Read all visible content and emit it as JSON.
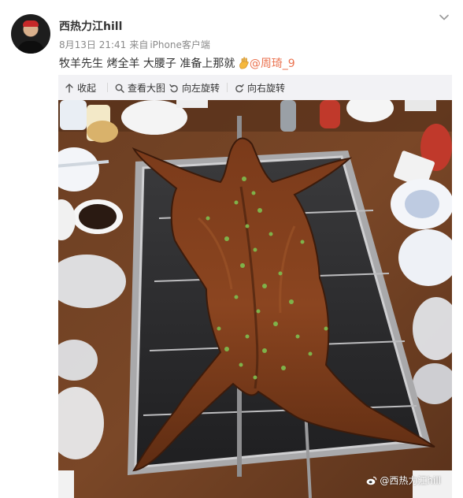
{
  "post": {
    "username": "西热力江hill",
    "date": "8月13日 21:41",
    "source_prefix": "来自",
    "source": "iPhone客户端",
    "text": "牧羊先生 烤全羊 大腰子 准备上那就 ",
    "mention": "@周琦_9"
  },
  "toolbar": {
    "collapse_label": "收起",
    "view_large_label": "查看大图",
    "rotate_left_label": "向左旋转",
    "rotate_right_label": "向右旋转"
  },
  "image": {
    "watermark": "@西热力江hill"
  },
  "colors": {
    "accent": "#eb7350",
    "meta_text": "#8a8a8a",
    "panel_bg": "#f2f2f5"
  }
}
